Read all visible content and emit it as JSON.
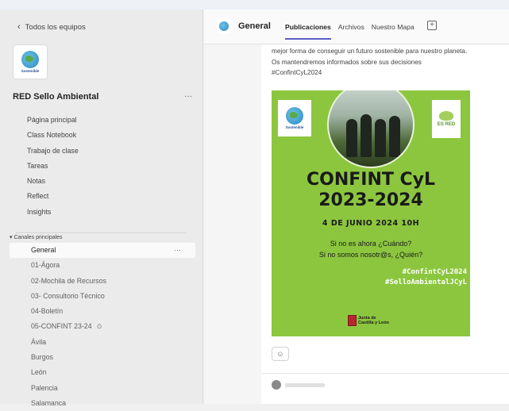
{
  "sidebar": {
    "back_label": "Todos los equipos",
    "team_logo_text": "Sostenible",
    "team_name": "RED Sello Ambiental",
    "team_more": "···",
    "nav": [
      "Página principal",
      "Class Notebook",
      "Trabajo de clase",
      "Tareas",
      "Notas",
      "Reflect",
      "Insights"
    ],
    "section_header": "▾ Canales principales",
    "channels": [
      {
        "label": "General",
        "active": true
      },
      {
        "label": "01-Ágora"
      },
      {
        "label": "02-Mochila de Recursos"
      },
      {
        "label": "03- Consultorio Técnico"
      },
      {
        "label": "04-Boletín"
      },
      {
        "label": "05-CONFINT 23-24",
        "badge": "⏲"
      },
      {
        "label": "Ávila"
      },
      {
        "label": "Burgos"
      },
      {
        "label": "León"
      },
      {
        "label": "Palencia"
      },
      {
        "label": "Salamanca"
      }
    ]
  },
  "header": {
    "channel_title": "General",
    "tabs": [
      "Publicaciones",
      "Archivos",
      "Nuestro Mapa"
    ],
    "add_tab": "+"
  },
  "post": {
    "text_lines": [
      "mejor forma de conseguir un futuro sostenible para nuestro planeta.",
      "Os mantendremos informados sobre sus decisiones",
      "#ConfintCyL2024"
    ],
    "poster": {
      "logo_left_text": "Sostenible",
      "logo_right_text": "ES RED",
      "title_line1": "CONFINT CyL",
      "title_line2": "2023-2024",
      "date": "4 DE JUNIO 2024 10H",
      "question1": "Si no es ahora ¿Cuándo?",
      "question2": "Si no somos nosotr@s, ¿Quién?",
      "tag1": "#ConfintCyL2024",
      "tag2": "#SelloAmbientalJCyL",
      "junta_line1": "Junta de",
      "junta_line2": "Castilla y León"
    },
    "reaction_icon": "☺"
  },
  "colors": {
    "accent": "#5b5fc7",
    "poster_green": "#8cc63f"
  }
}
